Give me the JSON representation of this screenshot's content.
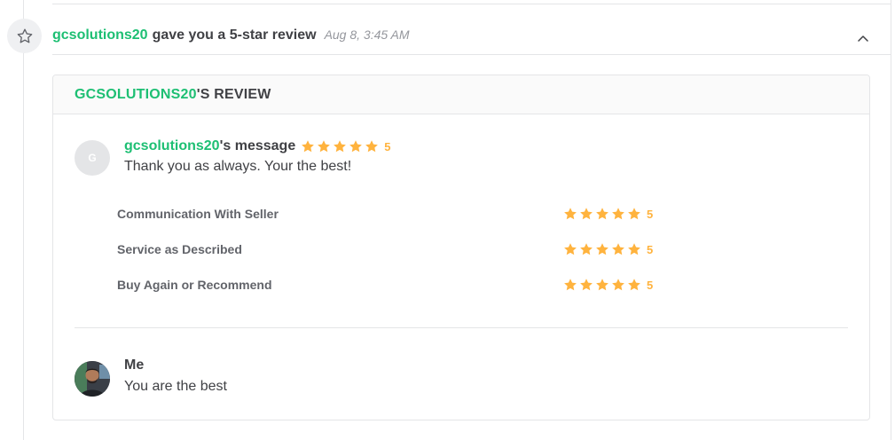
{
  "event": {
    "icon": "star-outline-icon",
    "username": "gcsolutions20",
    "action_text": "gave you a 5-star review",
    "timestamp": "Aug 8, 3:45 AM",
    "collapse_icon": "chevron-up-icon"
  },
  "review": {
    "header_name": "GCSOLUTIONS20",
    "header_suffix": "'S REVIEW",
    "buyer_avatar_initial": "G",
    "buyer_name": "gcsolutions20",
    "message_suffix": "'s message",
    "overall_rating": 5,
    "overall_rating_label": "5",
    "message_text": "Thank you as always. Your the best!",
    "criteria": [
      {
        "label": "Communication With Seller",
        "rating": 5,
        "rating_label": "5"
      },
      {
        "label": "Service as Described",
        "rating": 5,
        "rating_label": "5"
      },
      {
        "label": "Buy Again or Recommend",
        "rating": 5,
        "rating_label": "5"
      }
    ],
    "reply": {
      "author": "Me",
      "text": "You are the best"
    }
  },
  "colors": {
    "brand_green": "#1dbf73",
    "star_orange": "#ffb33e",
    "text_dark": "#404145",
    "text_muted": "#95979d",
    "border": "#e4e5e7"
  }
}
